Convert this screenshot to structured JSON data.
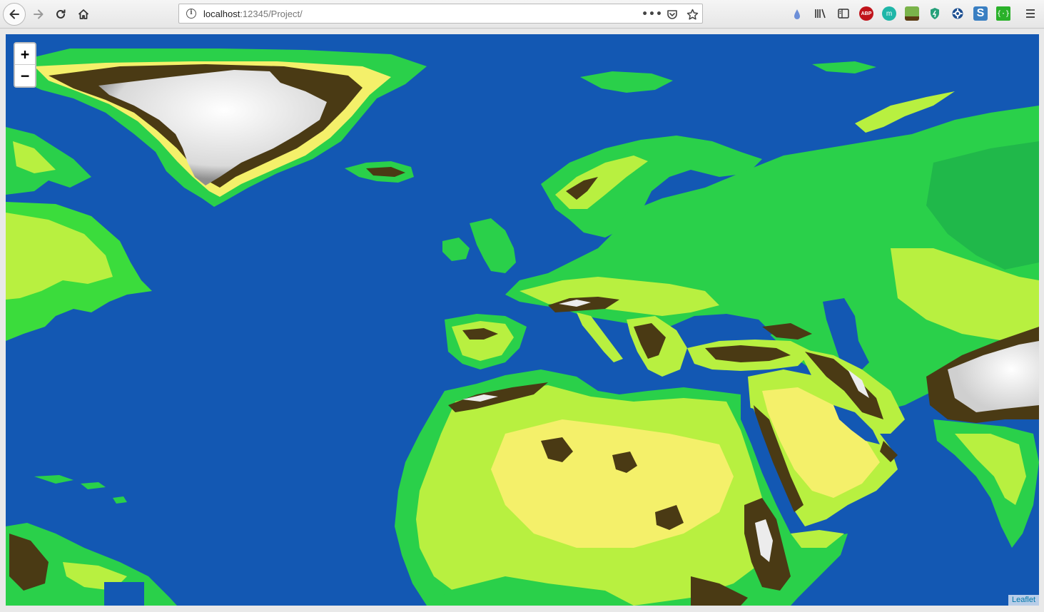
{
  "browser": {
    "url_host": "localhost",
    "url_rest": ":12345/Project/",
    "more_label": "•••",
    "extensions": {
      "abp_label": "ABP",
      "m_label": "m",
      "s_label": "S",
      "braces_label": "{·}"
    }
  },
  "map": {
    "zoom_in_label": "+",
    "zoom_out_label": "−",
    "attribution": "Leaflet",
    "colors": {
      "ocean": "#1358b3",
      "lowland": "#2ad04a",
      "midland": "#b8f040",
      "highland": "#f4f06a",
      "mountain": "#4a3a14",
      "ice": "#ececec"
    }
  }
}
